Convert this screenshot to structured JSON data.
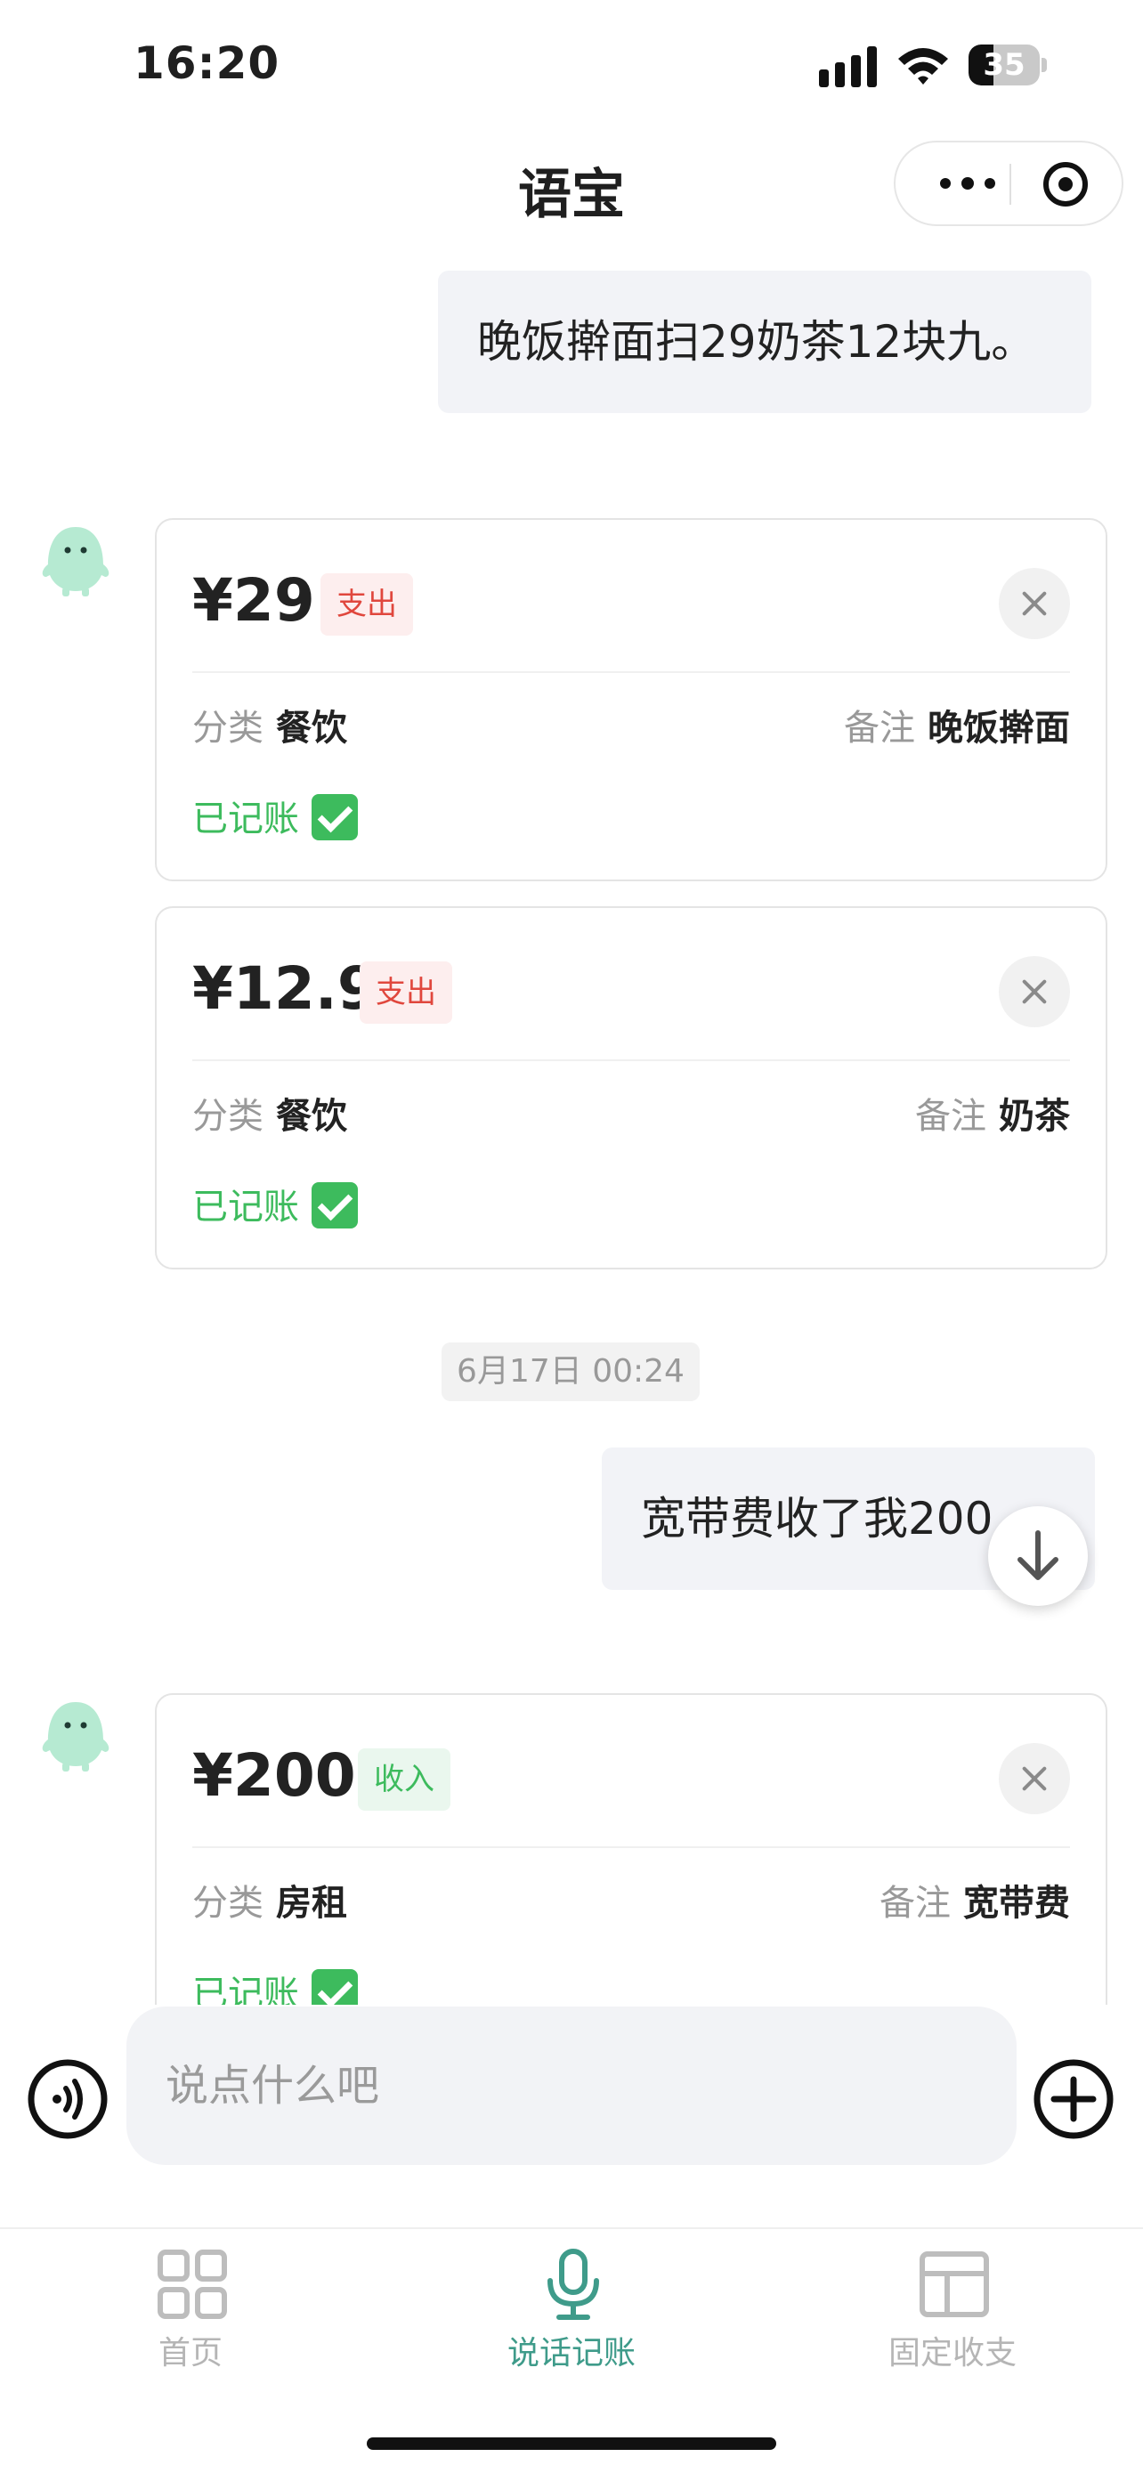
{
  "status_bar": {
    "time": "16:20",
    "battery": "35"
  },
  "nav": {
    "title": "语宝"
  },
  "messages": [
    {
      "role": "user",
      "text": "晚饭擀面扫29奶茶12块九。"
    },
    {
      "role": "user",
      "text": "宽带费收了我200"
    }
  ],
  "cards": [
    {
      "amount": "¥29",
      "type": "支出",
      "category_label": "分类",
      "category": "餐饮",
      "note_label": "备注",
      "note": "晚饭擀面",
      "status": "已记账"
    },
    {
      "amount": "¥12.9",
      "type": "支出",
      "category_label": "分类",
      "category": "餐饮",
      "note_label": "备注",
      "note": "奶茶",
      "status": "已记账"
    },
    {
      "amount": "¥200",
      "type": "收入",
      "category_label": "分类",
      "category": "房租",
      "note_label": "备注",
      "note": "宽带费",
      "status": "已记账"
    }
  ],
  "timestamp": "6月17日 00:24",
  "input": {
    "placeholder": "说点什么吧",
    "value": ""
  },
  "tabs": [
    {
      "label": "首页",
      "icon": "grid-icon",
      "active": false
    },
    {
      "label": "说话记账",
      "icon": "microphone-icon",
      "active": true
    },
    {
      "label": "固定收支",
      "icon": "layout-icon",
      "active": false
    }
  ],
  "colors": {
    "accent": "#3f9b8a",
    "expense": "#e0473d",
    "income": "#3dbb5d",
    "bubble": "#f2f3f7"
  }
}
